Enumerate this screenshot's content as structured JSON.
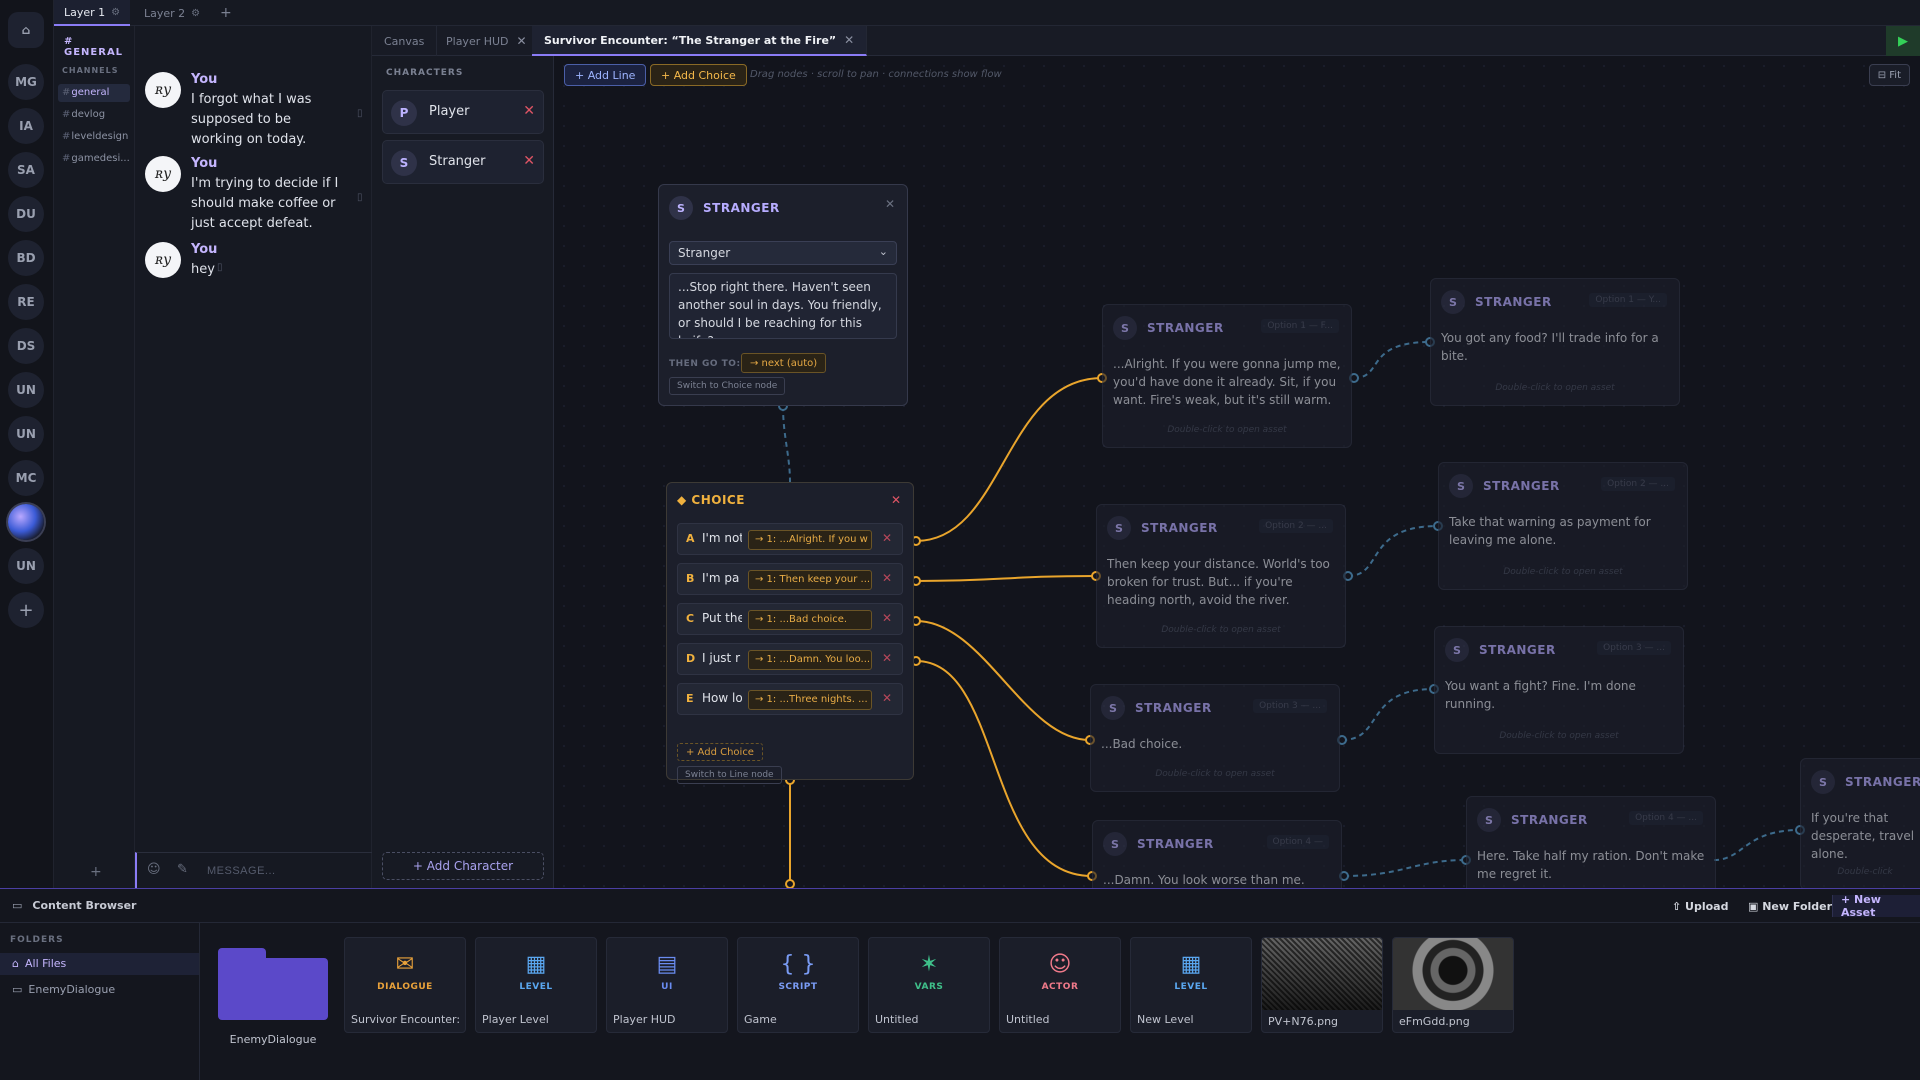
{
  "layers": {
    "tabs": [
      {
        "label": "Layer 1",
        "active": true
      },
      {
        "label": "Layer 2",
        "active": false
      }
    ]
  },
  "rail": {
    "servers": [
      "MG",
      "IA",
      "SA",
      "DU",
      "BD",
      "RE",
      "DS",
      "UN",
      "UN",
      "MC",
      "UN"
    ]
  },
  "guild": {
    "name": "# GENERAL",
    "channels_heading": "CHANNELS",
    "channels": [
      "general",
      "devlog",
      "leveldesign",
      "gamedesi..."
    ]
  },
  "chat": {
    "messages": [
      {
        "author": "You",
        "avatar": "ʀy",
        "text": "I forgot what I was supposed to be working on today."
      },
      {
        "author": "You",
        "avatar": "ʀy",
        "text": "I'm trying to decide if I should make coffee or just accept defeat."
      },
      {
        "author": "You",
        "avatar": "ʀy",
        "text": "hey"
      }
    ],
    "input_placeholder": "MESSAGE..."
  },
  "editor_tabs": [
    {
      "label": "Canvas",
      "closable": false
    },
    {
      "label": "Player HUD",
      "closable": true
    },
    {
      "label": "Survivor Encounter: “The Stranger at the Fire”",
      "closable": true,
      "active": true
    }
  ],
  "characters": {
    "heading": "CHARACTERS",
    "list": [
      {
        "initial": "P",
        "name": "Player"
      },
      {
        "initial": "S",
        "name": "Stranger"
      }
    ],
    "add_label": "+ Add Character"
  },
  "toolbar": {
    "add_line": "+ Add Line",
    "add_choice": "+ Add Choice",
    "hint": "Drag nodes · scroll to pan · connections show flow",
    "fit": "⊟ Fit"
  },
  "line_node": {
    "speaker": "STRANGER",
    "initial": "S",
    "selected": "Stranger",
    "text": "...Stop right there. Haven't seen another soul in days. You friendly, or should I be reaching for this knife?",
    "then_label": "THEN GO TO:",
    "next": "→ next (auto)",
    "switch": "Switch to Choice node"
  },
  "choice_node": {
    "title": "◆ CHOICE",
    "options": [
      {
        "letter": "A",
        "text": "I'm not",
        "goto": "→ 1: ...Alright. If you w"
      },
      {
        "letter": "B",
        "text": "I'm pa",
        "goto": "→ 1: Then keep your ..."
      },
      {
        "letter": "C",
        "text": "Put the kni",
        "goto": "→ 1: ...Bad choice."
      },
      {
        "letter": "D",
        "text": "I just r",
        "goto": "→ 1: ...Damn. You loo..."
      },
      {
        "letter": "E",
        "text": "How lo",
        "goto": "→ 1: ...Three nights. ..."
      }
    ],
    "add_choice": "+ Add Choice",
    "switch": "Switch to Line node"
  },
  "response_nodes": [
    {
      "speaker": "STRANGER",
      "initial": "S",
      "badge": "Option 1 — F...",
      "text": "...Alright. If you were gonna jump me, you'd have done it already. Sit, if you want. Fire's weak, but it's still warm.",
      "hint": "Double-click to open asset"
    },
    {
      "speaker": "STRANGER",
      "initial": "S",
      "badge": "Option 2 — ...",
      "text": "Then keep your distance. World's too broken for trust. But... if you're heading north, avoid the river. Something's stalki",
      "hint": "Double-click to open asset"
    },
    {
      "speaker": "STRANGER",
      "initial": "S",
      "badge": "Option 3 — ...",
      "text": "...Bad choice.",
      "hint": "Double-click to open asset"
    },
    {
      "speaker": "STRANGER",
      "initial": "S",
      "badge": "Option 4 —",
      "text": "...Damn. You look worse than me.",
      "hint": ""
    }
  ],
  "far_nodes": [
    {
      "speaker": "STRANGER",
      "initial": "S",
      "badge": "Option 1 — Y...",
      "text": "You got any food? I'll trade info for a bite.",
      "hint": "Double-click to open asset"
    },
    {
      "speaker": "STRANGER",
      "initial": "S",
      "badge": "Option 2 — ...",
      "text": "Take that warning as payment for leaving me alone.",
      "hint": "Double-click to open asset"
    },
    {
      "speaker": "STRANGER",
      "initial": "S",
      "badge": "Option 3 — ...",
      "text": "You want a fight? Fine. I'm done running.",
      "hint": "Double-click to open asset"
    },
    {
      "speaker": "STRANGER",
      "initial": "S",
      "badge": "Option 4 — ...",
      "text": "Here. Take half my ration. Don't make me regret it.",
      "hint": ""
    },
    {
      "speaker": "STRANGER",
      "initial": "S",
      "badge": "",
      "text": "If you're that desperate, travel alone. Sometimes people out here.",
      "hint": "Double-click"
    }
  ],
  "content_browser": {
    "title": "Content Browser",
    "upload": "⇧ Upload",
    "new_folder": "▣ New Folder",
    "new_asset": "+ New Asset",
    "folders_heading": "FOLDERS",
    "folders": [
      "All Files",
      "EnemyDialogue"
    ],
    "folder_tile": "EnemyDialogue",
    "assets": [
      {
        "kind": "DIALOGUE",
        "icon": "✉",
        "name": "Survivor Encounter: ...",
        "color": "#e8a13a"
      },
      {
        "kind": "LEVEL",
        "icon": "▦",
        "name": "Player Level",
        "color": "#5aa7f0"
      },
      {
        "kind": "UI",
        "icon": "▤",
        "name": "Player HUD",
        "color": "#6a8cf0"
      },
      {
        "kind": "SCRIPT",
        "icon": "{ }",
        "name": "Game",
        "color": "#7a9cf5"
      },
      {
        "kind": "VARS",
        "icon": "✶",
        "name": "Untitled",
        "color": "#3fc08a"
      },
      {
        "kind": "ACTOR",
        "icon": "☺",
        "name": "Untitled",
        "color": "#f07a8a"
      },
      {
        "kind": "LEVEL",
        "icon": "▦",
        "name": "New Level",
        "color": "#5aa7f0"
      }
    ],
    "images": [
      "PV+N76.png",
      "eFmGdd.png"
    ]
  }
}
